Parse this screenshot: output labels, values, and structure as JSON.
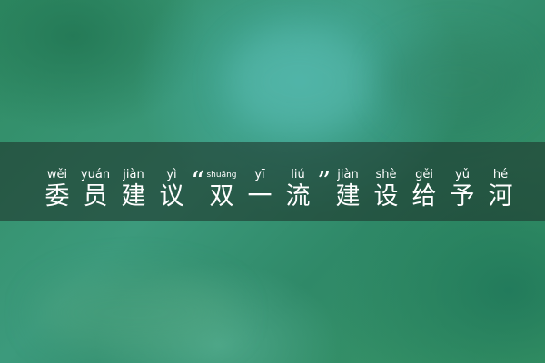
{
  "headline": {
    "chars": [
      {
        "py": "wěi",
        "hz": "委"
      },
      {
        "py": "yuán",
        "hz": "员"
      },
      {
        "py": "jiàn",
        "hz": "建"
      },
      {
        "py": "yì",
        "hz": "议"
      },
      {
        "quote": "“"
      },
      {
        "py": "shuāng",
        "hz": "双",
        "small": true
      },
      {
        "py": "yī",
        "hz": "一"
      },
      {
        "py": "liú",
        "hz": "流"
      },
      {
        "quote": "”"
      },
      {
        "py": "jiàn",
        "hz": "建"
      },
      {
        "py": "shè",
        "hz": "设"
      },
      {
        "py": "gěi",
        "hz": "给"
      },
      {
        "py": "yǔ",
        "hz": "予"
      },
      {
        "py": "hé",
        "hz": "河"
      }
    ]
  },
  "colors": {
    "band": "#1e372d",
    "text": "#ffffff"
  }
}
